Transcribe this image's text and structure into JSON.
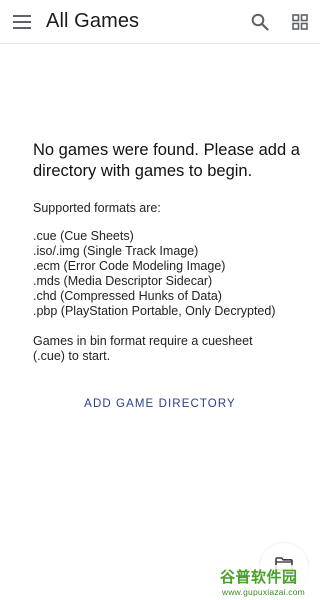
{
  "appbar": {
    "title": "All Games",
    "menu_icon": "menu-icon",
    "search_icon": "search-icon",
    "grid_icon": "grid-view-icon"
  },
  "empty_state": {
    "headline": "No games were found. Please add a directory with games to begin.",
    "formats_label": "Supported formats are:",
    "formats": [
      ".cue (Cue Sheets)",
      ".iso/.img (Single Track Image)",
      ".ecm (Error Code Modeling Image)",
      ".mds (Media Descriptor Sidecar)",
      ".chd (Compressed Hunks of Data)",
      ".pbp (PlayStation Portable, Only Decrypted)"
    ],
    "note": "Games in bin format require a cuesheet (.cue) to start.",
    "add_button_label": "ADD GAME DIRECTORY"
  },
  "fab": {
    "icon": "folder-icon"
  },
  "watermark": {
    "main": "谷普软件园",
    "sub": "www.gupuxiazai.com"
  },
  "colors": {
    "accent": "#2a3e8e",
    "watermark_green": "#4aa12a",
    "watermark_orange": "#f39a1c"
  }
}
